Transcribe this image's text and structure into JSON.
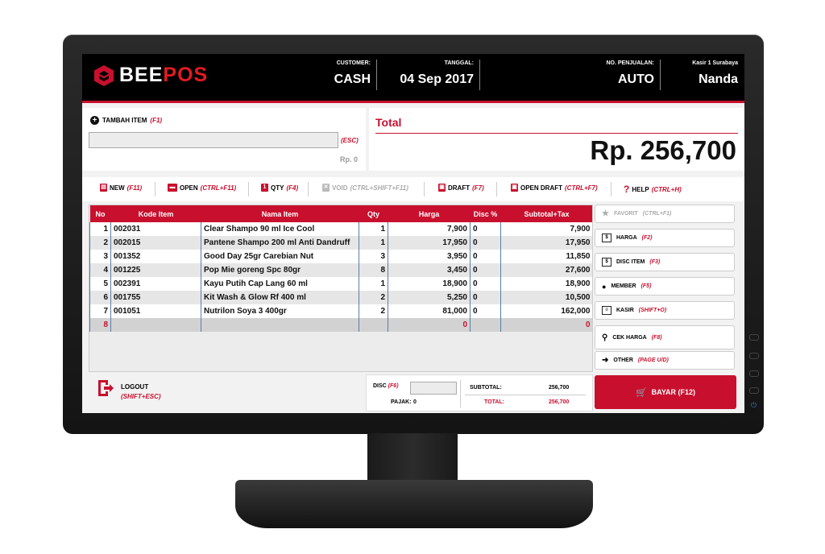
{
  "header": {
    "brand": {
      "part1": "BEE",
      "part2": "POS"
    },
    "customer": {
      "label": "CUSTOMER:",
      "value": "CASH"
    },
    "tanggal": {
      "label": "TANGGAL:",
      "value": "04 Sep 2017"
    },
    "no_penjualan": {
      "label": "NO. PENJUALAN:",
      "value": "AUTO"
    },
    "kasir": {
      "label": "Kasir 1 Surabaya",
      "value": "Nanda"
    }
  },
  "add_item": {
    "label": "TAMBAH ITEM",
    "shortcut": "(F1)",
    "input_value": "",
    "esc": "(ESC)",
    "price": "Rp. 0"
  },
  "total": {
    "label": "Total",
    "value": "Rp. 256,700"
  },
  "toolbar": [
    {
      "label": "NEW",
      "shortcut": "(F11)"
    },
    {
      "label": "OPEN",
      "shortcut": "(CTRL+F11)"
    },
    {
      "label": "QTY",
      "shortcut": "(F4)"
    },
    {
      "label": "VOID",
      "shortcut": "(CTRL+SHIFT+F11)"
    },
    {
      "label": "DRAFT",
      "shortcut": "(F7)"
    },
    {
      "label": "OPEN DRAFT",
      "shortcut": "(CTRL+F7)"
    },
    {
      "label": "HELP",
      "shortcut": "(CTRL+H)"
    }
  ],
  "table": {
    "headers": [
      "No",
      "Kode Item",
      "Nama Item",
      "Qty",
      "Harga",
      "Disc %",
      "Subtotal+Tax"
    ],
    "rows": [
      [
        "1",
        "002031",
        "Clear Shampo 90 ml Ice Cool",
        "1",
        "7,900",
        "0",
        "7,900"
      ],
      [
        "2",
        "002015",
        "Pantene Shampo 200 ml Anti Dandruff",
        "1",
        "17,950",
        "0",
        "17,950"
      ],
      [
        "3",
        "001352",
        "Good Day 25gr Carebian Nut",
        "3",
        "3,950",
        "0",
        "11,850"
      ],
      [
        "4",
        "001225",
        "Pop Mie goreng Spc 80gr",
        "8",
        "3,450",
        "0",
        "27,600"
      ],
      [
        "5",
        "002391",
        "Kayu Putih Cap Lang 60 ml",
        "1",
        "18,900",
        "0",
        "18,900"
      ],
      [
        "6",
        "001755",
        "Kit Wash & Glow Rf 400 ml",
        "2",
        "5,250",
        "0",
        "10,500"
      ],
      [
        "7",
        "001051",
        "Nutrilon Soya 3 400gr",
        "2",
        "81,000",
        "0",
        "162,000"
      ]
    ],
    "new_row": [
      "8",
      "",
      "",
      "",
      "0",
      "",
      "0"
    ]
  },
  "side_buttons": [
    {
      "label": "FAVORIT",
      "shortcut": "(CTRL+F1)",
      "icon": "star-icon"
    },
    {
      "label": "HARGA",
      "shortcut": "(F2)",
      "icon": "price-icon"
    },
    {
      "label": "DISC ITEM",
      "shortcut": "(F3)",
      "icon": "discount-icon"
    },
    {
      "label": "MEMBER",
      "shortcut": "(F5)",
      "icon": "user-icon"
    },
    {
      "label": "KASIR",
      "shortcut": "(SHIFT+O)",
      "icon": "cashier-icon"
    },
    {
      "label": "CEK HARGA",
      "shortcut": "(F8)",
      "icon": "search-icon"
    },
    {
      "label": "OTHER",
      "shortcut": "(PAGE U/D)",
      "icon": "arrow-right-icon"
    }
  ],
  "bayar": {
    "label": "BAYAR (F12)"
  },
  "logout": {
    "label": "LOGOUT",
    "shortcut": "(SHIFT+ESC)"
  },
  "summary": {
    "disc_label": "DISC",
    "disc_shortcut": "(F6)",
    "disc_value": "",
    "pajak_label": "PAJAK:",
    "pajak_value": "0",
    "subtotal_label": "SUBTOTAL:",
    "subtotal_value": "256,700",
    "total_label": "TOTAL:",
    "total_value": "256,700"
  },
  "colors": {
    "accent": "#c8102e",
    "header_bg": "#000000"
  }
}
